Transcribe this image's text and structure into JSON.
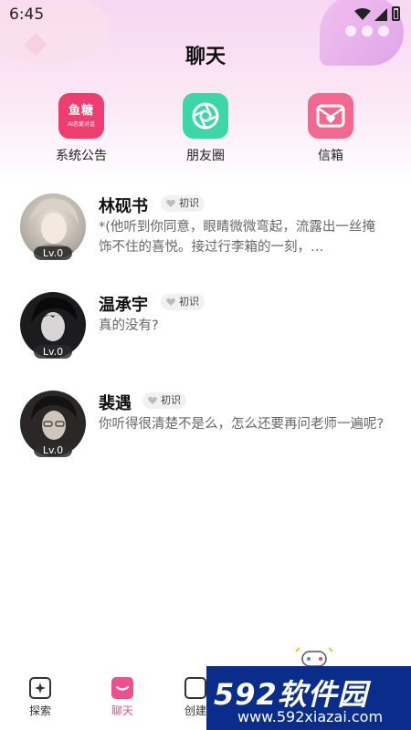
{
  "status": {
    "time": "6:45"
  },
  "header": {
    "title": "聊天"
  },
  "quick_actions": [
    {
      "label": "系统公告",
      "icon": "system-notice-icon",
      "icon_text": "鱼糖",
      "icon_subtext": "AI恋爱对话",
      "color": "#ee3d6e"
    },
    {
      "label": "朋友圈",
      "icon": "camera-shutter-icon",
      "color": "#3dd6ab"
    },
    {
      "label": "信箱",
      "icon": "mailbox-icon",
      "color": "#f2688f"
    }
  ],
  "chats": [
    {
      "name": "林砚书",
      "tag": "初识",
      "level": "Lv.0",
      "message": "*(他听到你同意，眼睛微微弯起，流露出一丝掩饰不住的喜悦。接过行李箱的一刻，…"
    },
    {
      "name": "温承宇",
      "tag": "初识",
      "level": "Lv.0",
      "message": "真的没有?"
    },
    {
      "name": "裴遇",
      "tag": "初识",
      "level": "Lv.0",
      "message": "你听得很清楚不是么，怎么还要再问老师一遍呢?"
    }
  ],
  "tabbar": {
    "tabs": [
      {
        "label": "探索",
        "icon": "explore-card-icon"
      },
      {
        "label": "聊天",
        "icon": "chat-bubble-icon",
        "active": true
      },
      {
        "label": "创建",
        "icon": "create-icon"
      }
    ]
  },
  "watermark": {
    "brand": "592软件园",
    "url": "www.592xiazai.com"
  },
  "colors": {
    "accent": "#ee4f8d",
    "watermark_bg": "#0a2d8c"
  }
}
